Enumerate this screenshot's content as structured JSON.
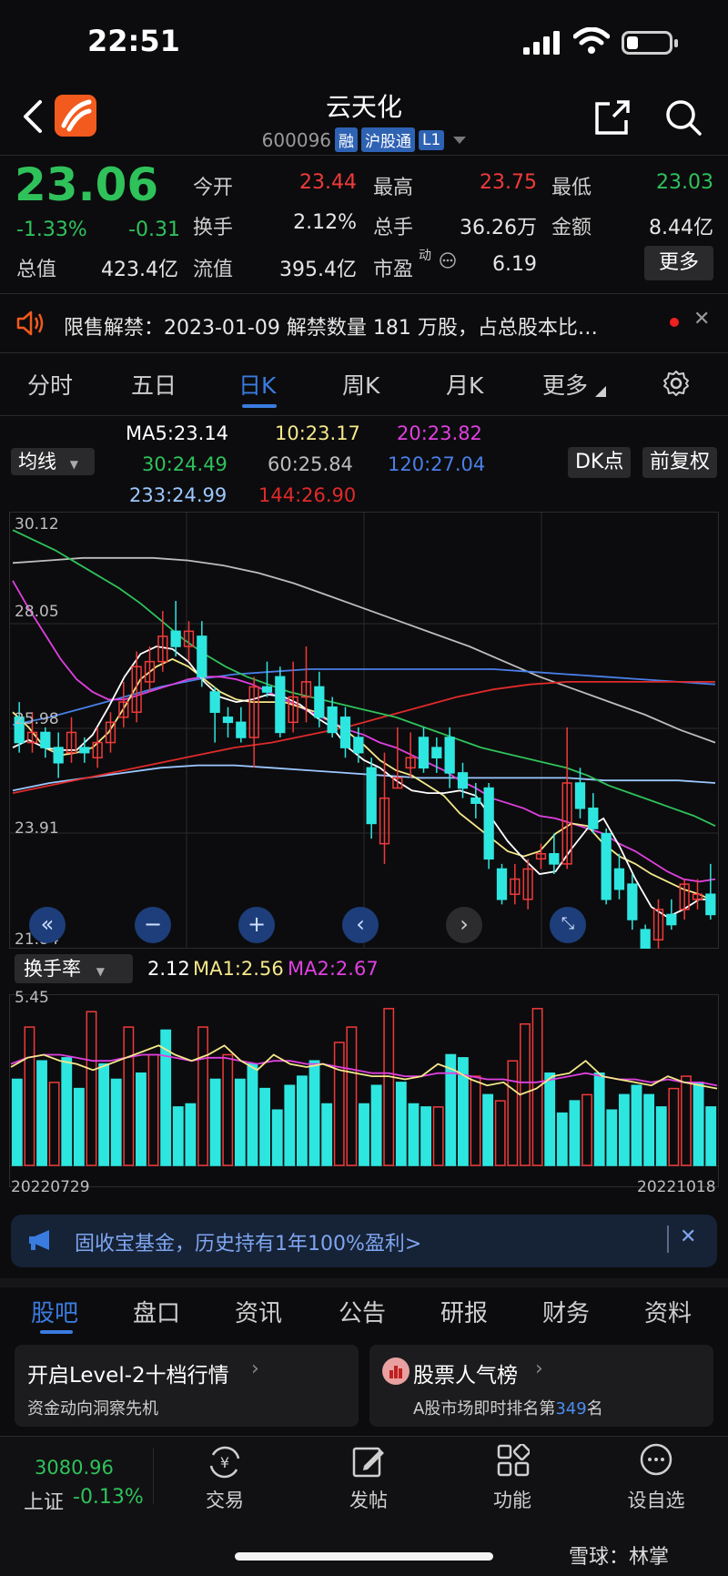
{
  "status_bar": {
    "time": "22:51"
  },
  "header": {
    "stock_name": "云天化",
    "code": "600096",
    "tags": [
      "融",
      "沪股通",
      "L1"
    ]
  },
  "quote": {
    "price": "23.06",
    "change_pct": "-1.33%",
    "change": "-0.31",
    "open_label": "今开",
    "open": "23.44",
    "high_label": "最高",
    "high": "23.75",
    "low_label": "最低",
    "low": "23.03",
    "turnover_label": "换手",
    "turnover": "2.12%",
    "volume_label": "总手",
    "volume": "36.26万",
    "amount_label": "金额",
    "amount": "8.44亿",
    "mktcap_label": "总值",
    "mktcap": "423.4亿",
    "float_label": "流值",
    "float": "395.4亿",
    "pe_label": "市盈",
    "pe_sup": "动",
    "pe": "6.19",
    "more": "更多"
  },
  "notice": {
    "text": "限售解禁：2023-01-09 解禁数量 181 万股，占总股本比…"
  },
  "period_tabs": [
    "分时",
    "五日",
    "日K",
    "周K",
    "月K",
    "更多"
  ],
  "ma": {
    "selector": "均线",
    "ma5": "MA5:23.14",
    "ma10": "10:23.17",
    "ma20": "20:23.82",
    "ma30": "30:24.49",
    "ma60": "60:25.84",
    "ma120": "120:27.04",
    "ma233": "233:24.99",
    "ma144": "144:26.90",
    "dk_button": "DK点",
    "adjust_button": "前复权"
  },
  "colors": {
    "up": "#f03a3a",
    "down": "#2ee6e0",
    "ma5": "#ffffff",
    "ma10": "#f5e88a",
    "ma20": "#e040e0",
    "ma30": "#2fc25b",
    "ma60": "#bdbdbd",
    "ma120": "#4a7fe8",
    "ma233": "#9cc8ff",
    "ma144": "#e02a2a"
  },
  "chart_data": [
    {
      "type": "candlestick",
      "y_ticks": [
        "30.12",
        "28.05",
        "25.98",
        "23.91",
        "21.84"
      ],
      "ylim": [
        21.84,
        30.12
      ],
      "candles": [
        [
          26.2,
          25.7,
          26.5,
          25.5
        ],
        [
          25.7,
          25.9,
          26.3,
          25.5
        ],
        [
          25.9,
          25.6,
          26.0,
          25.4
        ],
        [
          25.6,
          25.3,
          25.9,
          25.0
        ],
        [
          25.5,
          25.9,
          26.2,
          25.3
        ],
        [
          25.6,
          25.5,
          25.8,
          25.3
        ],
        [
          25.4,
          25.7,
          26.0,
          25.2
        ],
        [
          25.7,
          26.1,
          26.3,
          25.5
        ],
        [
          26.2,
          26.5,
          26.9,
          26.0
        ],
        [
          26.3,
          27.2,
          27.5,
          26.1
        ],
        [
          26.9,
          27.3,
          27.6,
          26.7
        ],
        [
          27.3,
          27.8,
          28.3,
          27.1
        ],
        [
          27.9,
          27.6,
          28.5,
          27.4
        ],
        [
          27.6,
          27.9,
          28.1,
          27.3
        ],
        [
          27.8,
          27.0,
          28.1,
          26.8
        ],
        [
          26.7,
          26.3,
          26.8,
          25.7
        ],
        [
          26.2,
          26.1,
          26.4,
          25.8
        ],
        [
          26.1,
          25.8,
          26.4,
          25.7
        ],
        [
          25.8,
          26.8,
          27.0,
          25.2
        ],
        [
          26.8,
          26.7,
          27.3,
          26.6
        ],
        [
          27.0,
          25.9,
          27.2,
          25.8
        ],
        [
          26.1,
          26.6,
          27.3,
          25.9
        ],
        [
          26.6,
          26.9,
          27.6,
          26.1
        ],
        [
          26.8,
          26.2,
          27.1,
          26.0
        ],
        [
          26.4,
          25.9,
          26.6,
          25.8
        ],
        [
          26.2,
          25.6,
          26.4,
          25.4
        ],
        [
          25.8,
          25.5,
          26.0,
          25.3
        ],
        [
          25.2,
          24.1,
          25.4,
          23.8
        ],
        [
          23.7,
          24.6,
          25.5,
          23.3
        ],
        [
          24.8,
          25.0,
          26.0,
          24.8
        ],
        [
          25.2,
          25.4,
          25.9,
          25.0
        ],
        [
          25.8,
          25.2,
          26.0,
          25.1
        ],
        [
          25.6,
          25.4,
          25.8,
          25.1
        ],
        [
          25.8,
          25.1,
          26.0,
          24.8
        ],
        [
          25.1,
          24.8,
          25.3,
          24.6
        ],
        [
          24.6,
          24.5,
          24.9,
          24.2
        ],
        [
          24.8,
          23.4,
          24.9,
          23.2
        ],
        [
          23.2,
          22.6,
          23.3,
          22.5
        ],
        [
          22.7,
          23.0,
          23.3,
          22.5
        ],
        [
          22.6,
          23.2,
          23.4,
          22.4
        ],
        [
          23.4,
          23.5,
          23.7,
          23.2
        ],
        [
          23.5,
          23.3,
          23.9,
          23.1
        ],
        [
          23.3,
          24.9,
          26.0,
          23.2
        ],
        [
          24.9,
          24.4,
          25.2,
          24.2
        ],
        [
          24.4,
          24.0,
          24.7,
          23.9
        ],
        [
          23.9,
          22.6,
          24.0,
          22.5
        ],
        [
          23.2,
          22.8,
          23.5,
          22.6
        ],
        [
          22.9,
          22.2,
          23.1,
          22.0
        ],
        [
          22.0,
          21.6,
          22.1,
          21.5
        ],
        [
          21.8,
          22.4,
          22.6,
          21.2
        ],
        [
          22.3,
          22.1,
          22.6,
          22.0
        ],
        [
          22.4,
          22.9,
          23.0,
          22.2
        ],
        [
          22.6,
          22.7,
          23.0,
          22.4
        ],
        [
          22.7,
          22.3,
          23.3,
          22.2
        ]
      ],
      "ma_lines": {
        "ma5": [
          25.6,
          25.75,
          25.6,
          25.55,
          25.55,
          25.85,
          26.4,
          27.0,
          27.45,
          27.6,
          27.55,
          27.3,
          26.9,
          26.6,
          26.5,
          26.55,
          26.65,
          26.6,
          26.45,
          26.2,
          26.0,
          25.6,
          25.35,
          25.2,
          24.95,
          24.75,
          24.7,
          24.7,
          24.75,
          24.65,
          24.2,
          23.75,
          23.4,
          23.1,
          23.15,
          23.6,
          24.0,
          24.2,
          23.65,
          23.0,
          22.45,
          22.25,
          22.4,
          22.6,
          22.6
        ],
        "ma10": [
          26.3,
          26.0,
          25.6,
          25.45,
          25.5,
          25.6,
          25.9,
          26.4,
          26.95,
          27.2,
          27.35,
          27.2,
          26.95,
          26.7,
          26.55,
          26.5,
          26.5,
          26.5,
          26.4,
          26.3,
          26.1,
          25.9,
          25.65,
          25.35,
          25.15,
          25.05,
          24.85,
          24.65,
          24.3,
          24.05,
          23.8,
          23.55,
          23.45,
          23.55,
          23.9,
          24.1,
          24.05,
          23.7,
          23.45,
          23.3,
          23.1,
          22.95,
          22.8,
          22.7,
          22.55
        ],
        "ma20": [
          28.9,
          28.35,
          27.85,
          27.35,
          26.95,
          26.7,
          26.55,
          26.55,
          26.65,
          26.75,
          26.85,
          26.95,
          27.0,
          27.0,
          26.95,
          26.85,
          26.7,
          26.55,
          26.4,
          26.25,
          26.1,
          25.95,
          25.85,
          25.7,
          25.6,
          25.45,
          25.3,
          25.15,
          24.95,
          24.8,
          24.6,
          24.5,
          24.4,
          24.25,
          24.2,
          24.1,
          24.0,
          23.9,
          23.7,
          23.55,
          23.35,
          23.15,
          23.0,
          22.95,
          23.0
        ],
        "ma30": [
          29.9,
          29.7,
          29.5,
          29.25,
          29.0,
          28.75,
          28.45,
          28.1,
          27.75,
          27.45,
          27.2,
          27.0,
          26.85,
          26.7,
          26.6,
          26.5,
          26.4,
          26.3,
          26.2,
          26.05,
          25.9,
          25.75,
          25.6,
          25.5,
          25.4,
          25.3,
          25.2,
          25.05,
          24.85,
          24.7,
          24.55,
          24.4,
          24.25,
          24.05
        ],
        "ma60": [
          29.25,
          29.3,
          29.35,
          29.35,
          29.35,
          29.3,
          29.2,
          29.05,
          28.85,
          28.6,
          28.35,
          28.1,
          27.85,
          27.6,
          27.3,
          27.0,
          26.75,
          26.5,
          26.25,
          25.95,
          25.7
        ],
        "ma120": [
          26.05,
          26.2,
          26.4,
          26.6,
          26.8,
          26.95,
          27.05,
          27.1,
          27.15,
          27.15,
          27.15,
          27.15,
          27.15,
          27.15,
          27.1,
          27.05,
          27.0,
          26.95,
          26.9,
          26.85
        ],
        "ma233": [
          24.75,
          24.9,
          25.0,
          25.1,
          25.2,
          25.25,
          25.25,
          25.2,
          25.15,
          25.1,
          25.05,
          25.0,
          25.0,
          25.0,
          25.0,
          25.0,
          24.95,
          24.95,
          24.95,
          24.9
        ],
        "ma144": [
          24.7,
          24.85,
          25.0,
          25.15,
          25.3,
          25.45,
          25.6,
          25.7,
          25.85,
          26.0,
          26.2,
          26.4,
          26.6,
          26.75,
          26.85,
          26.9,
          26.9,
          26.9,
          26.9,
          26.9
        ]
      }
    },
    {
      "type": "bar",
      "title": "换手率",
      "values_label": "2.12",
      "ma1_label": "MA1:2.56",
      "ma2_label": "MA2:2.67",
      "y_top": "5.45",
      "ylim": [
        0,
        5.45
      ],
      "x_start": "20220729",
      "x_end": "20221018",
      "bars": [
        2.8,
        4.5,
        3.4,
        2.7,
        3.5,
        2.5,
        5.0,
        3.3,
        2.8,
        4.5,
        3.0,
        3.6,
        4.4,
        1.9,
        2.0,
        4.5,
        2.8,
        3.6,
        2.8,
        3.3,
        2.5,
        1.8,
        2.6,
        2.9,
        3.4,
        2.0,
        4.0,
        4.5,
        2.0,
        2.6,
        5.1,
        2.7,
        2.0,
        1.9,
        1.9,
        3.6,
        3.5,
        2.9,
        2.3,
        2.1,
        3.4,
        4.6,
        5.1,
        3.0,
        1.7,
        2.1,
        2.3,
        3.0,
        1.8,
        2.3,
        2.6,
        2.3,
        1.9,
        2.5,
        2.9,
        2.7,
        1.9
      ],
      "bar_up": [
        false,
        true,
        false,
        true,
        false,
        false,
        true,
        false,
        false,
        true,
        false,
        true,
        false,
        false,
        false,
        true,
        false,
        true,
        false,
        false,
        false,
        false,
        false,
        false,
        false,
        false,
        true,
        true,
        false,
        false,
        true,
        false,
        false,
        false,
        true,
        false,
        false,
        true,
        false,
        true,
        true,
        true,
        true,
        false,
        false,
        false,
        true,
        false,
        false,
        false,
        false,
        false,
        false,
        true,
        true,
        false,
        false
      ],
      "ma1_line": [
        3.2,
        3.5,
        3.6,
        3.4,
        3.3,
        3.1,
        3.3,
        3.5,
        3.7,
        3.9,
        3.6,
        3.4,
        3.6,
        3.9,
        3.4,
        3.1,
        3.6,
        3.3,
        3.2,
        3.3,
        3.1,
        3.0,
        2.9,
        2.9,
        2.8,
        2.9,
        3.3,
        3.1,
        2.8,
        2.6,
        2.7,
        2.3,
        2.5,
        2.9,
        3.0,
        3.4,
        2.9,
        2.8,
        2.7,
        2.6,
        2.9,
        2.7,
        2.6,
        2.5
      ],
      "ma2_line": [
        3.3,
        3.5,
        3.6,
        3.6,
        3.5,
        3.4,
        3.4,
        3.5,
        3.6,
        3.6,
        3.5,
        3.4,
        3.5,
        3.5,
        3.4,
        3.3,
        3.4,
        3.4,
        3.3,
        3.3,
        3.2,
        3.1,
        3.0,
        3.0,
        2.9,
        2.9,
        3.0,
        3.0,
        2.9,
        2.8,
        2.8,
        2.7,
        2.7,
        2.8,
        2.9,
        3.0,
        2.9,
        2.8,
        2.8,
        2.7,
        2.8,
        2.7,
        2.7,
        2.6
      ]
    }
  ],
  "ad": {
    "text": "固收宝基金，历史持有1年100%盈利>"
  },
  "bottom_tabs": [
    "股吧",
    "盘口",
    "资讯",
    "公告",
    "研报",
    "财务",
    "资料"
  ],
  "cards": {
    "level2_title": "开启Level-2十档行情",
    "level2_sub": "资金动向洞察先机",
    "rank_title": "股票人气榜",
    "rank_sub_pre": "A股市场即时排名第",
    "rank_num": "349",
    "rank_sub_post": "名"
  },
  "nav": {
    "index_value": "3080.96",
    "index_name": "上证",
    "index_change": "-0.13%",
    "items": [
      "交易",
      "发帖",
      "功能",
      "设自选"
    ]
  },
  "watermark": "雪球：林掌"
}
